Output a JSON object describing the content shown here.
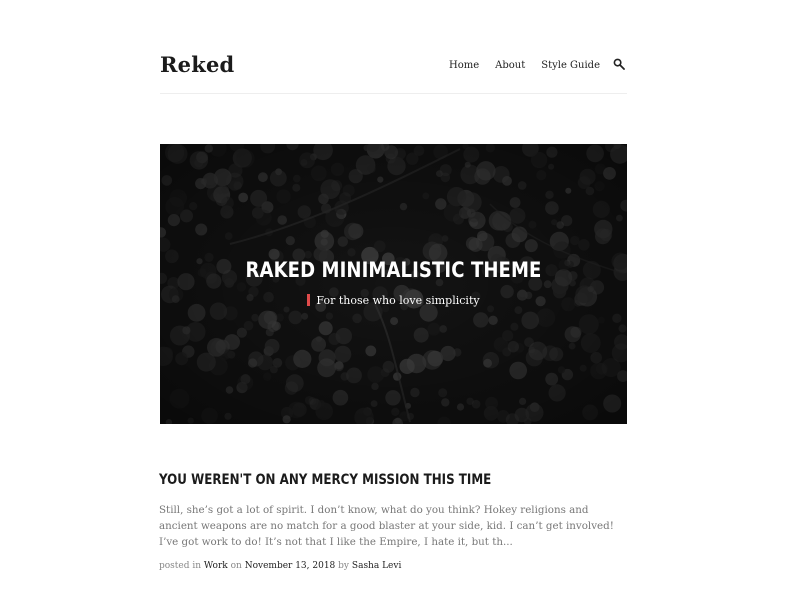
{
  "site": {
    "logo": "Reked"
  },
  "nav": {
    "items": [
      {
        "label": "Home"
      },
      {
        "label": "About"
      },
      {
        "label": "Style Guide"
      }
    ],
    "search_icon": "search-icon"
  },
  "hero": {
    "title": "RAKED MINIMALISTIC THEME",
    "subtitle": "For those who love simplicity",
    "accent_color": "#e04b4b"
  },
  "post": {
    "title": "YOU WEREN'T ON ANY MERCY MISSION THIS TIME",
    "excerpt": "Still, she’s got a lot of spirit. I don’t know, what do you think? Hokey religions and ancient weapons are no match for a good blaster at your side, kid. I can’t get involved! I’ve got work to do! It’s not that I like the Empire, I hate it, but th...",
    "meta": {
      "posted_in_label": "posted in",
      "category": "Work",
      "on_label": "on",
      "date": "November 13, 2018",
      "by_label": "by",
      "author": "Sasha Levi"
    }
  }
}
